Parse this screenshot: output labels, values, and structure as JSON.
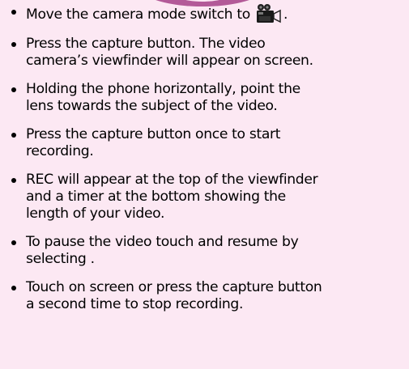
{
  "steps": [
    {
      "text": "Move the camera mode switch to ",
      "suffix": "."
    },
    {
      "text": "Press the capture button. The video\ncamera’s viewfinder will appear on screen."
    },
    {
      "text": "Holding the phone horizontally, point the\nlens towards the subject of the video."
    },
    {
      "text": "Press the capture button once to start\nrecording."
    },
    {
      "text": "REC will appear at the top of the viewfinder\nand a timer at the bottom showing the\nlength of your video."
    },
    {
      "text": "To pause the video touch and resume by\nselecting ."
    },
    {
      "text": "Touch on screen or press the capture button\na second time to stop recording."
    }
  ],
  "icons": {
    "camera_mode": "video-camera-icon"
  }
}
